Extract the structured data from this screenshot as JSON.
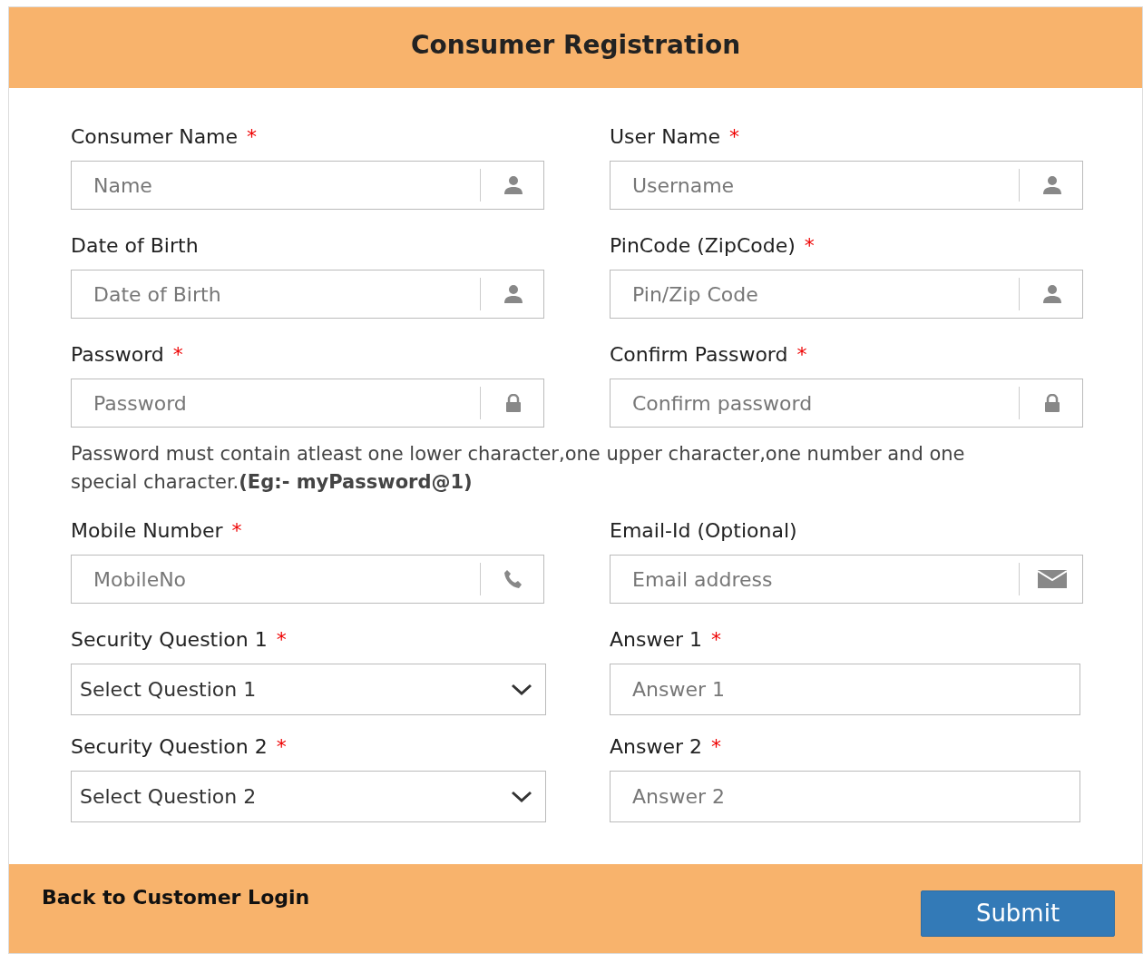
{
  "header": {
    "title": "Consumer Registration"
  },
  "rows": [
    [
      {
        "label": "Consumer Name",
        "mark": "*",
        "kind": "input-user",
        "placeholder": "Name"
      },
      {
        "label": "User Name",
        "mark": "*",
        "kind": "input-user",
        "placeholder": "Username"
      }
    ],
    [
      {
        "label": "Date of Birth",
        "kind": "input-user",
        "placeholder": "Date of Birth"
      },
      {
        "label": "PinCode (ZipCode)",
        "mark": "*",
        "kind": "input-user",
        "placeholder": "Pin/Zip Code"
      }
    ],
    [
      {
        "label": "Password",
        "mark": "*",
        "kind": "input-lock",
        "placeholder": "Password"
      },
      {
        "label": "Confirm Password",
        "mark": "*",
        "kind": "input-lock",
        "placeholder": "Confirm password"
      }
    ]
  ],
  "hint": "Password must contain atleast one lower character,one upper character,one number and one special character.**(Eg:- myPassword@1)**",
  "rows2": [
    [
      {
        "label": "Mobile Number",
        "mark": "*",
        "kind": "input-phone",
        "placeholder": "MobileNo"
      },
      {
        "label": "Email-Id (Optional)",
        "kind": "input-mail",
        "placeholder": "Email address"
      }
    ],
    [
      {
        "label": "Security Question 1",
        "mark": "*",
        "kind": "select",
        "value": "Select Question 1"
      },
      {
        "label": "Answer 1",
        "mark": "*",
        "kind": "input",
        "placeholder": "Answer 1"
      }
    ],
    [
      {
        "label": "Security Question 2",
        "mark": "*",
        "kind": "select",
        "value": "Select Question 2"
      },
      {
        "label": "Answer 2",
        "mark": "*",
        "kind": "input",
        "placeholder": "Answer 2"
      }
    ]
  ],
  "footer": {
    "link": "Back to Customer Login",
    "button": "Submit"
  }
}
